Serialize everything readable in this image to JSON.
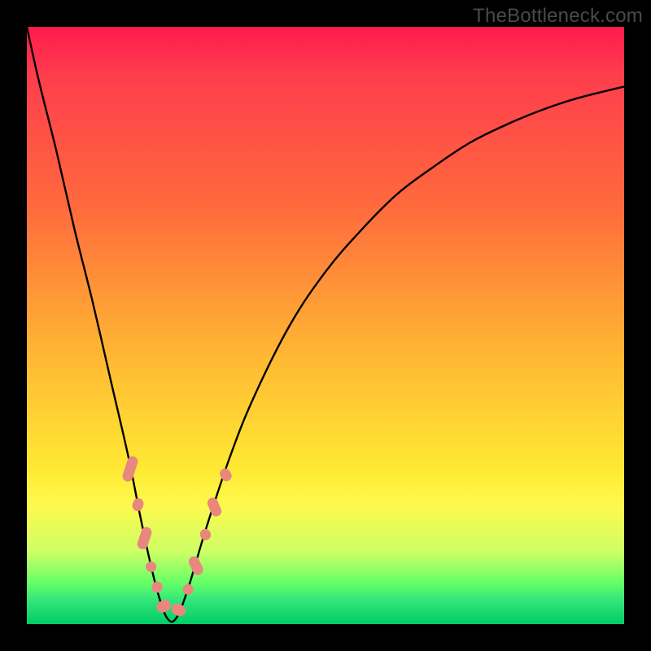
{
  "watermark": "TheBottleneck.com",
  "colors": {
    "bead": "#e9877e",
    "curve": "#000000",
    "frame": "#000000"
  },
  "chart_data": {
    "type": "line",
    "title": "",
    "xlabel": "",
    "ylabel": "",
    "xlim": [
      0,
      100
    ],
    "ylim": [
      0,
      100
    ],
    "x": [
      0,
      2,
      5,
      8,
      11,
      14,
      17,
      19,
      20.5,
      22,
      23.5,
      25,
      27,
      30,
      34,
      38,
      44,
      50,
      56,
      62,
      68,
      74,
      80,
      86,
      92,
      100
    ],
    "values": [
      100,
      91,
      79,
      66,
      54,
      41,
      28,
      18,
      11,
      5,
      1,
      1,
      6,
      16,
      28,
      38,
      50,
      59,
      66,
      72,
      76.5,
      80.5,
      83.5,
      86,
      88,
      90
    ],
    "note": "x is horizontal position in %, values is vertical height in % from bottom (0 = bottom green band, 100 = top red). Curve is a V/valley shape bottoming near x≈24.",
    "beads": {
      "note": "Pink capsule markers clustered around the valley on both branches, rendered as rounded rectangles along the curve.",
      "left_branch": [
        {
          "x_pct": 17.3,
          "y_pct": 26.0,
          "len": 32,
          "w": 13,
          "angle": -72
        },
        {
          "x_pct": 18.6,
          "y_pct": 20.0,
          "len": 16,
          "w": 13,
          "angle": -72
        },
        {
          "x_pct": 19.7,
          "y_pct": 14.4,
          "len": 28,
          "w": 13,
          "angle": -72
        },
        {
          "x_pct": 20.8,
          "y_pct": 9.6,
          "len": 13,
          "w": 13,
          "angle": -72
        },
        {
          "x_pct": 21.8,
          "y_pct": 6.2,
          "len": 14,
          "w": 13,
          "angle": -66
        }
      ],
      "trough": [
        {
          "x_pct": 22.9,
          "y_pct": 3.0,
          "len": 18,
          "w": 14,
          "angle": -25
        },
        {
          "x_pct": 25.4,
          "y_pct": 2.4,
          "len": 18,
          "w": 14,
          "angle": 25
        }
      ],
      "right_branch": [
        {
          "x_pct": 27.0,
          "y_pct": 5.8,
          "len": 13,
          "w": 13,
          "angle": 63
        },
        {
          "x_pct": 28.3,
          "y_pct": 9.8,
          "len": 24,
          "w": 13,
          "angle": 65
        },
        {
          "x_pct": 29.9,
          "y_pct": 15.0,
          "len": 14,
          "w": 13,
          "angle": 67
        },
        {
          "x_pct": 31.4,
          "y_pct": 19.6,
          "len": 24,
          "w": 13,
          "angle": 67
        },
        {
          "x_pct": 33.3,
          "y_pct": 25.0,
          "len": 16,
          "w": 13,
          "angle": 62
        }
      ]
    }
  }
}
